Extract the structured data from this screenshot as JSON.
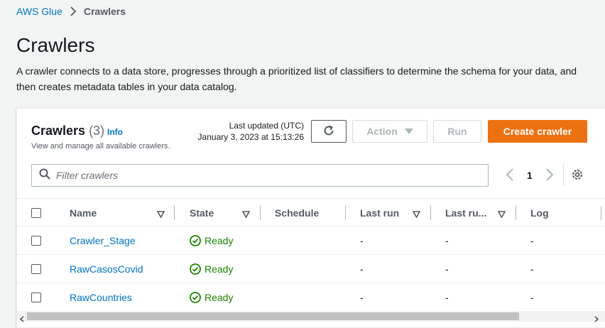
{
  "breadcrumb": {
    "root": "AWS Glue",
    "current": "Crawlers"
  },
  "page": {
    "title": "Crawlers",
    "description": "A crawler connects to a data store, progresses through a prioritized list of classifiers to determine the schema for your data, and then creates metadata tables in your data catalog."
  },
  "panel": {
    "title": "Crawlers",
    "count": "(3)",
    "info": "Info",
    "subtitle": "View and manage all available crawlers.",
    "last_updated_label": "Last updated (UTC)",
    "last_updated_value": "January 3, 2023 at 15:13:26"
  },
  "toolbar": {
    "action_label": "Action",
    "run_label": "Run",
    "create_label": "Create crawler"
  },
  "search": {
    "placeholder": "Filter crawlers"
  },
  "pagination": {
    "current": "1"
  },
  "columns": [
    "Name",
    "State",
    "Schedule",
    "Last run",
    "Last ru...",
    "Log"
  ],
  "rows": [
    {
      "name": "Crawler_Stage",
      "state": "Ready",
      "schedule": "",
      "last_run": "-",
      "last_run2": "-",
      "log": "-"
    },
    {
      "name": "RawCasosCovid",
      "state": "Ready",
      "schedule": "",
      "last_run": "-",
      "last_run2": "-",
      "log": "-"
    },
    {
      "name": "RawCountries",
      "state": "Ready",
      "schedule": "",
      "last_run": "-",
      "last_run2": "-",
      "log": "-"
    }
  ],
  "colors": {
    "accent": "#ec7211",
    "link": "#0073bb",
    "success": "#1d8102"
  },
  "icons": [
    "chevron-right-icon",
    "refresh-icon",
    "caret-down-icon",
    "search-icon",
    "chevron-left-icon",
    "gear-icon",
    "sort-icon",
    "success-icon"
  ]
}
